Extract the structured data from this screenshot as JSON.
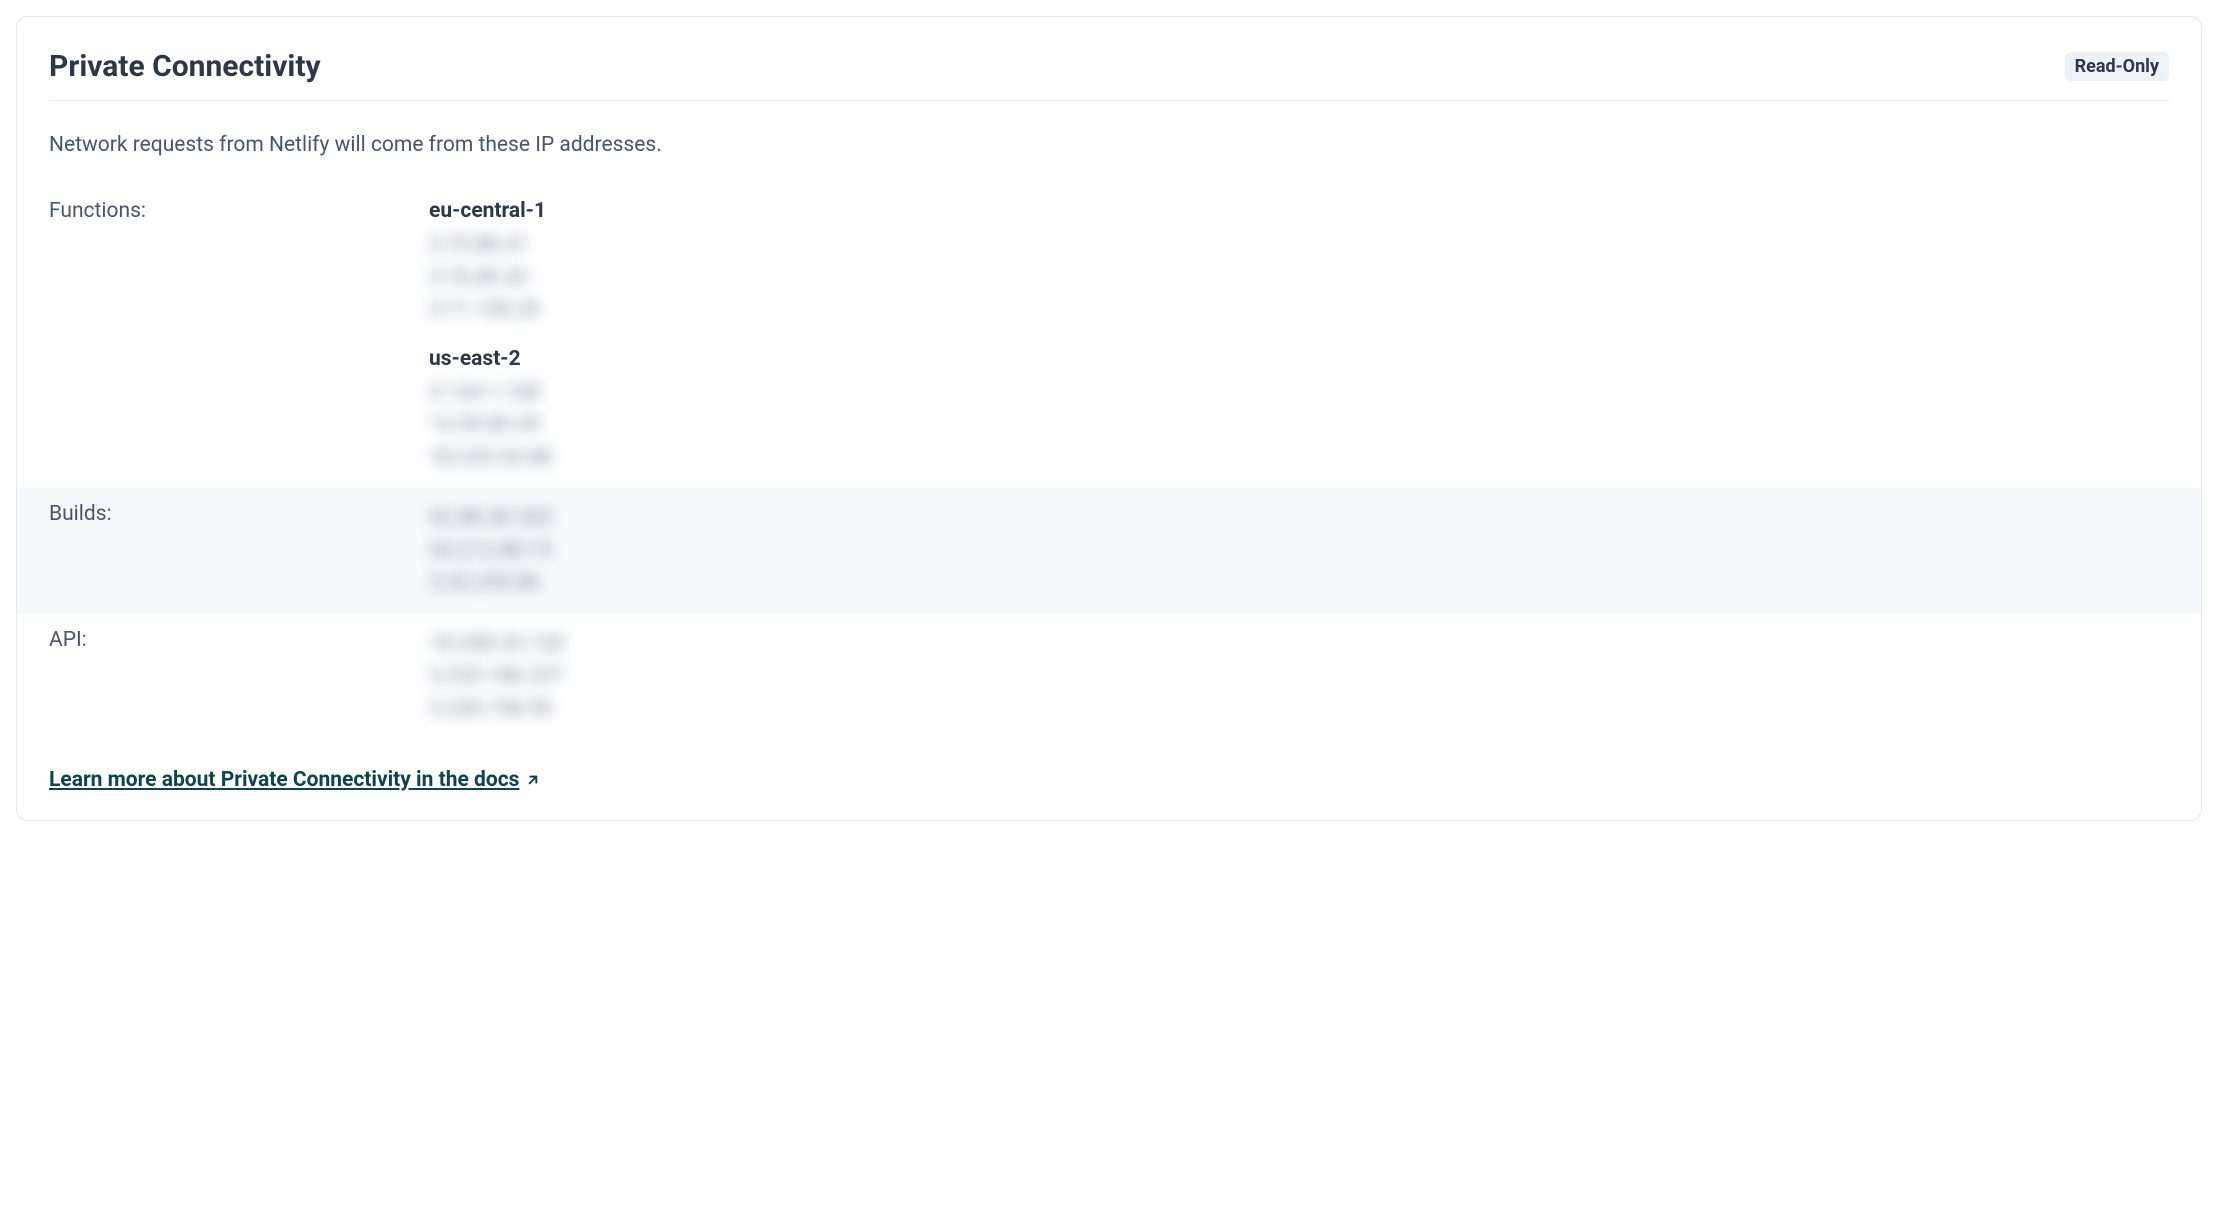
{
  "panel": {
    "title": "Private Connectivity",
    "badge": "Read-Only",
    "description": "Network requests from Netlify will come from these IP addresses."
  },
  "rows": {
    "functions": {
      "label": "Functions:",
      "regions": [
        {
          "name": "eu-central-1",
          "ips": [
            "3.70.88.41",
            "3.76.80.43",
            "3.71.109.29"
          ]
        },
        {
          "name": "us-east-2",
          "ips": [
            "3.134.1.108",
            "13.59.80.39",
            "18.225.33.88"
          ]
        }
      ]
    },
    "builds": {
      "label": "Builds:",
      "ips": [
        "52.88.49.203",
        "34.212.88.19",
        "3.93.239.86"
      ]
    },
    "api": {
      "label": "API:",
      "ips": [
        "18.208.33.128",
        "3.220.186.237",
        "3.230.198.59"
      ]
    }
  },
  "link": {
    "label": "Learn more about Private Connectivity in the docs"
  }
}
